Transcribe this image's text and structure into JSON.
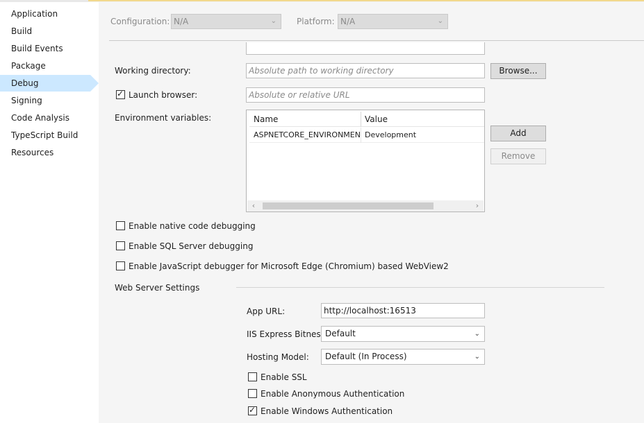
{
  "sidebar": {
    "items": [
      {
        "label": "Application"
      },
      {
        "label": "Build"
      },
      {
        "label": "Build Events"
      },
      {
        "label": "Package"
      },
      {
        "label": "Debug"
      },
      {
        "label": "Signing"
      },
      {
        "label": "Code Analysis"
      },
      {
        "label": "TypeScript Build"
      },
      {
        "label": "Resources"
      }
    ],
    "active": "Debug"
  },
  "toolbar": {
    "configuration_label": "Configuration:",
    "configuration_value": "N/A",
    "platform_label": "Platform:",
    "platform_value": "N/A"
  },
  "debug": {
    "working_directory_label": "Working directory:",
    "working_directory_placeholder": "Absolute path to working directory",
    "browse_label": "Browse...",
    "launch_browser_label": "Launch browser:",
    "launch_browser_checked": true,
    "launch_browser_placeholder": "Absolute or relative URL",
    "env_vars_label": "Environment variables:",
    "env_columns": [
      "Name",
      "Value"
    ],
    "env_rows": [
      {
        "name": "ASPNETCORE_ENVIRONMENT",
        "value": "Development"
      }
    ],
    "add_label": "Add",
    "remove_label": "Remove",
    "options": [
      {
        "label": "Enable native code debugging",
        "checked": false
      },
      {
        "label": "Enable SQL Server debugging",
        "checked": false
      },
      {
        "label": "Enable JavaScript debugger for Microsoft Edge (Chromium) based WebView2",
        "checked": false
      }
    ]
  },
  "web_server": {
    "section_label": "Web Server Settings",
    "app_url_label": "App URL:",
    "app_url_value": "http://localhost:16513",
    "bitness_label": "IIS Express Bitness:",
    "bitness_value": "Default",
    "hosting_label": "Hosting Model:",
    "hosting_value": "Default (In Process)",
    "auth_options": [
      {
        "label": "Enable SSL",
        "checked": false
      },
      {
        "label": "Enable Anonymous Authentication",
        "checked": false
      },
      {
        "label": "Enable Windows Authentication",
        "checked": true
      }
    ]
  },
  "icons": {
    "chevron": "chevron-down-icon",
    "check": "checkmark-icon",
    "scroll_left": "chevron-left-icon",
    "scroll_right": "chevron-right-icon"
  }
}
